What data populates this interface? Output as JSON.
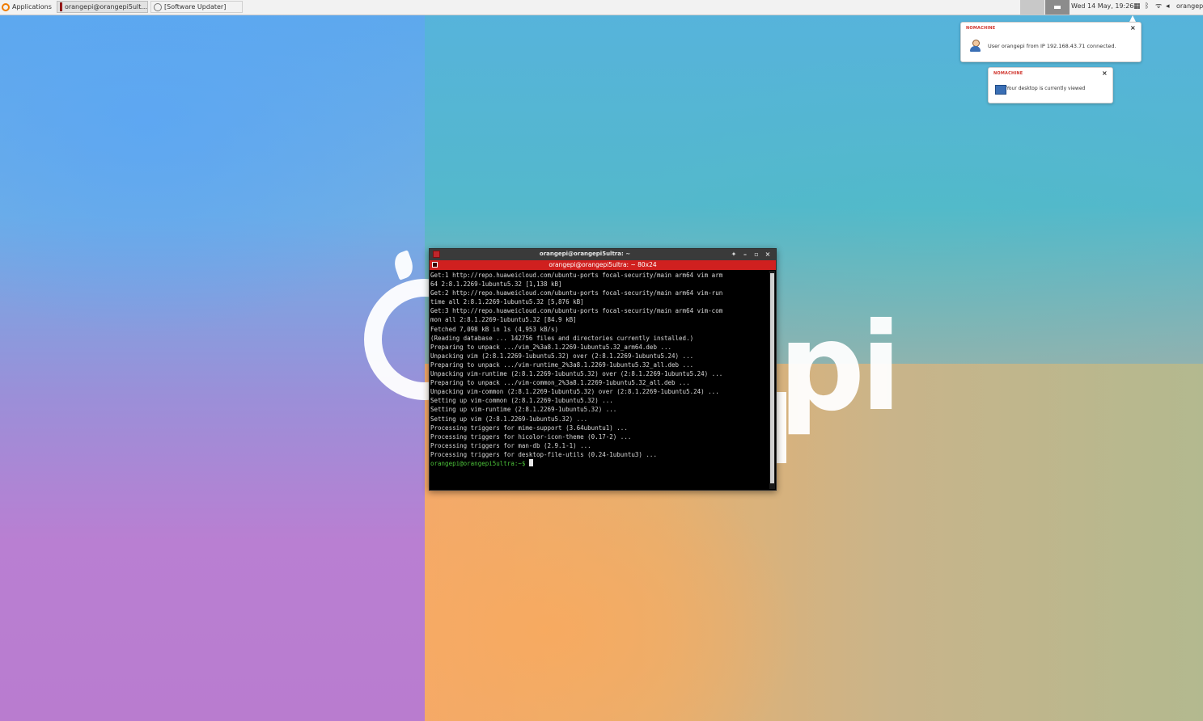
{
  "taskbar": {
    "applications_label": "Applications",
    "tasks": [
      {
        "label": "orangepi@orangepi5ult...",
        "icon": "terminal-icon"
      },
      {
        "label": "[Software Updater]",
        "icon": "gear-icon"
      }
    ],
    "clock": "Wed 14 May, 19:26",
    "user": "orangepi"
  },
  "notifications": [
    {
      "title": "NOMACHINE",
      "body": "User orangepi from IP 192.168.43.71 connected.",
      "icon": "user-icon"
    },
    {
      "title": "NOMACHINE",
      "body": "Your desktop is currently viewed",
      "icon": "screen-icon"
    }
  ],
  "wallpaper": {
    "logo_text": "pi"
  },
  "terminal": {
    "title": "orangepi@orangepi5ultra: ~",
    "tab_title": "orangepi@orangepi5ultra: ~ 80x24",
    "lines": [
      "Get:1 http://repo.huaweicloud.com/ubuntu-ports focal-security/main arm64 vim arm",
      "64 2:8.1.2269-1ubuntu5.32 [1,138 kB]",
      "Get:2 http://repo.huaweicloud.com/ubuntu-ports focal-security/main arm64 vim-run",
      "time all 2:8.1.2269-1ubuntu5.32 [5,876 kB]",
      "Get:3 http://repo.huaweicloud.com/ubuntu-ports focal-security/main arm64 vim-com",
      "mon all 2:8.1.2269-1ubuntu5.32 [84.9 kB]",
      "Fetched 7,098 kB in 1s (4,953 kB/s)",
      "(Reading database ... 142756 files and directories currently installed.)",
      "Preparing to unpack .../vim_2%3a8.1.2269-1ubuntu5.32_arm64.deb ...",
      "Unpacking vim (2:8.1.2269-1ubuntu5.32) over (2:8.1.2269-1ubuntu5.24) ...",
      "Preparing to unpack .../vim-runtime_2%3a8.1.2269-1ubuntu5.32_all.deb ...",
      "Unpacking vim-runtime (2:8.1.2269-1ubuntu5.32) over (2:8.1.2269-1ubuntu5.24) ...",
      "Preparing to unpack .../vim-common_2%3a8.1.2269-1ubuntu5.32_all.deb ...",
      "Unpacking vim-common (2:8.1.2269-1ubuntu5.32) over (2:8.1.2269-1ubuntu5.24) ...",
      "Setting up vim-common (2:8.1.2269-1ubuntu5.32) ...",
      "Setting up vim-runtime (2:8.1.2269-1ubuntu5.32) ...",
      "Setting up vim (2:8.1.2269-1ubuntu5.32) ...",
      "Processing triggers for mime-support (3.64ubuntu1) ...",
      "Processing triggers for hicolor-icon-theme (0.17-2) ...",
      "Processing triggers for man-db (2.9.1-1) ...",
      "Processing triggers for desktop-file-utils (0.24-1ubuntu3) ..."
    ],
    "prompt": "orangepi@orangepi5ultra:~$ "
  }
}
